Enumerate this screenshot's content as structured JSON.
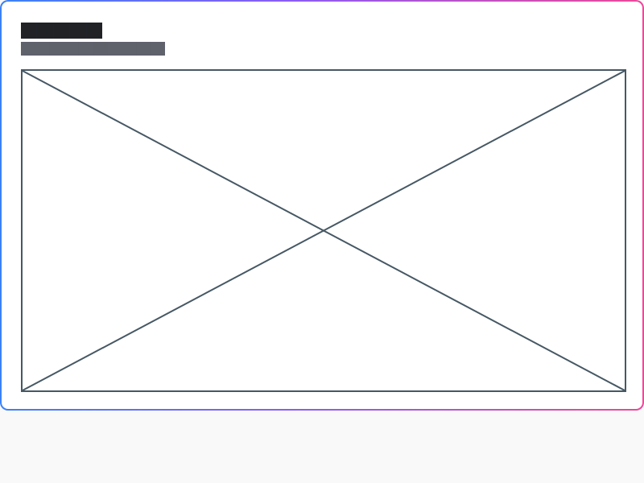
{
  "card": {
    "title": "",
    "subtitle": "",
    "media": {
      "icon": "image-placeholder-icon"
    }
  },
  "colors": {
    "border_gradient_start": "#3b82f6",
    "border_gradient_mid": "#8b5cf6",
    "border_gradient_end": "#ec4899",
    "placeholder_stroke": "#465864"
  }
}
